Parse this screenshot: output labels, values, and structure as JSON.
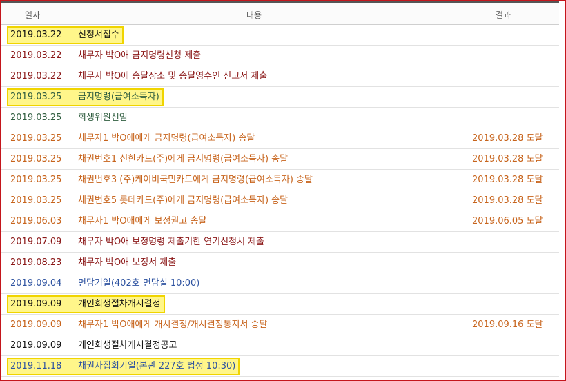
{
  "header": {
    "date": "일자",
    "content": "내용",
    "result": "결과"
  },
  "colors": {
    "dark": "#222222",
    "maroon": "#8a1616",
    "orange": "#c7631b",
    "green": "#2f5d3f",
    "blue": "#2d52a0",
    "black": "#111111",
    "highlight": "#fff68a",
    "highlight_border": "#f0d400",
    "frame": "#c4161c"
  },
  "rows": [
    {
      "date": "2019.03.22",
      "content": "신청서접수",
      "result": "",
      "color": "black",
      "highlighted": true
    },
    {
      "date": "2019.03.22",
      "content": "채무자 박O애 금지명령신청 제출",
      "result": "",
      "color": "maroon",
      "highlighted": false
    },
    {
      "date": "2019.03.22",
      "content": "채무자 박O애 송달장소 및 송달영수인 신고서 제출",
      "result": "",
      "color": "maroon",
      "highlighted": false
    },
    {
      "date": "2019.03.25",
      "content": "금지명령(급여소득자)",
      "result": "",
      "color": "green",
      "highlighted": true
    },
    {
      "date": "2019.03.25",
      "content": "회생위원선임",
      "result": "",
      "color": "green",
      "highlighted": false
    },
    {
      "date": "2019.03.25",
      "content": "채무자1 박O애에게 금지명령(급여소득자) 송달",
      "result": "2019.03.28 도달",
      "color": "orange",
      "highlighted": false
    },
    {
      "date": "2019.03.25",
      "content": "채권번호1 신한카드(주)에게 금지명령(급여소득자) 송달",
      "result": "2019.03.28 도달",
      "color": "orange",
      "highlighted": false
    },
    {
      "date": "2019.03.25",
      "content": "채권번호3 (주)케이비국민카드에게 금지명령(급여소득자) 송달",
      "result": "2019.03.28 도달",
      "color": "orange",
      "highlighted": false
    },
    {
      "date": "2019.03.25",
      "content": "채권번호5 롯데카드(주)에게 금지명령(급여소득자) 송달",
      "result": "2019.03.28 도달",
      "color": "orange",
      "highlighted": false
    },
    {
      "date": "2019.06.03",
      "content": "채무자1 박O애에게 보정권고 송달",
      "result": "2019.06.05 도달",
      "color": "orange",
      "highlighted": false
    },
    {
      "date": "2019.07.09",
      "content": "채무자 박O애 보정명령 제출기한 연기신청서 제출",
      "result": "",
      "color": "maroon",
      "highlighted": false
    },
    {
      "date": "2019.08.23",
      "content": "채무자 박O애 보정서 제출",
      "result": "",
      "color": "maroon",
      "highlighted": false
    },
    {
      "date": "2019.09.04",
      "content": "면담기일(402호 면담실 10:00)",
      "result": "",
      "color": "blue",
      "highlighted": false
    },
    {
      "date": "2019.09.09",
      "content": "개인회생절차개시결정",
      "result": "",
      "color": "black",
      "highlighted": true
    },
    {
      "date": "2019.09.09",
      "content": "채무자1 박O애에게 개시결정/개시결정통지서 송달",
      "result": "2019.09.16 도달",
      "color": "orange",
      "highlighted": false
    },
    {
      "date": "2019.09.09",
      "content": "개인회생절차개시결정공고",
      "result": "",
      "color": "black",
      "highlighted": false
    },
    {
      "date": "2019.11.18",
      "content": "채권자집회기일(본관 227호 법정 10:30)",
      "result": "",
      "color": "blue",
      "highlighted": true
    }
  ]
}
